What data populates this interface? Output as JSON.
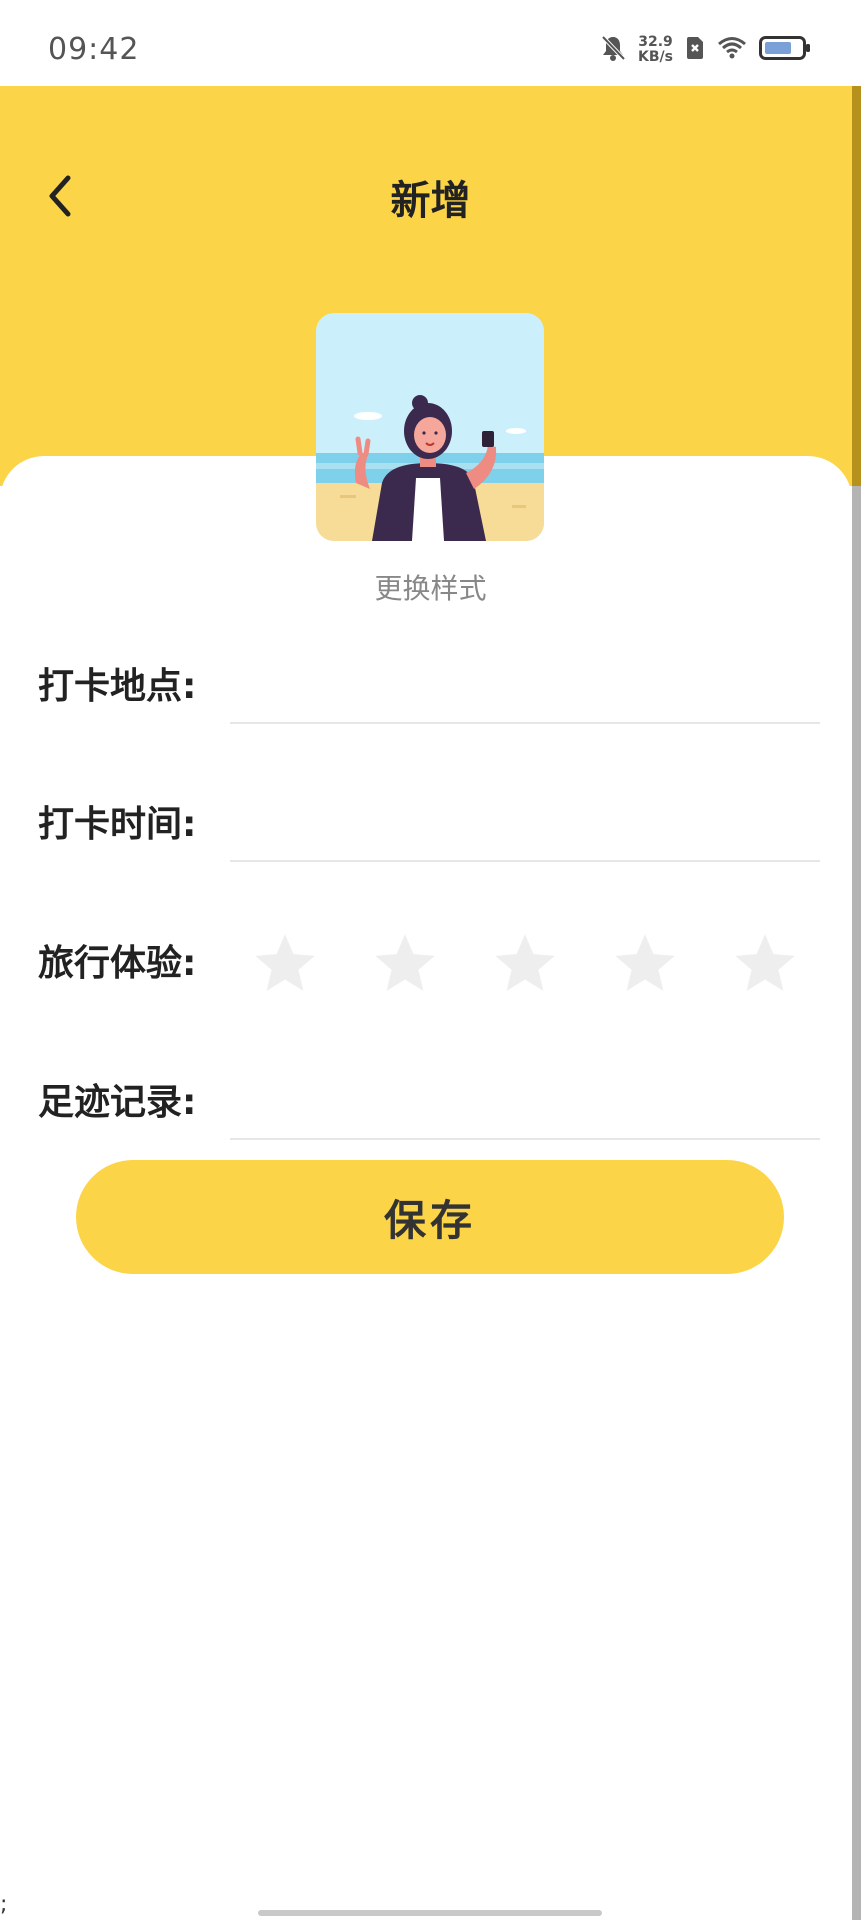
{
  "status_bar": {
    "time": "09:42",
    "net_speed_value": "32.9",
    "net_speed_unit": "KB/s",
    "icons": [
      "bell-muted-icon",
      "sim-x-icon",
      "wifi-icon",
      "battery-icon"
    ]
  },
  "header": {
    "title": "新增",
    "back_icon": "chevron-left-icon",
    "background_color": "#fcd448"
  },
  "avatar": {
    "change_label": "更换样式"
  },
  "form": {
    "location_label": "打卡地点:",
    "location_value": "",
    "time_label": "打卡时间:",
    "time_value": "",
    "rating_label": "旅行体验:",
    "rating_value": 0,
    "rating_max": 5,
    "notes_label": "足迹记录:",
    "notes_value": ""
  },
  "save_label": "保存",
  "footer_text": ";",
  "colors": {
    "accent": "#fcd448",
    "star_empty": "#eeeeee",
    "text": "#222222"
  }
}
